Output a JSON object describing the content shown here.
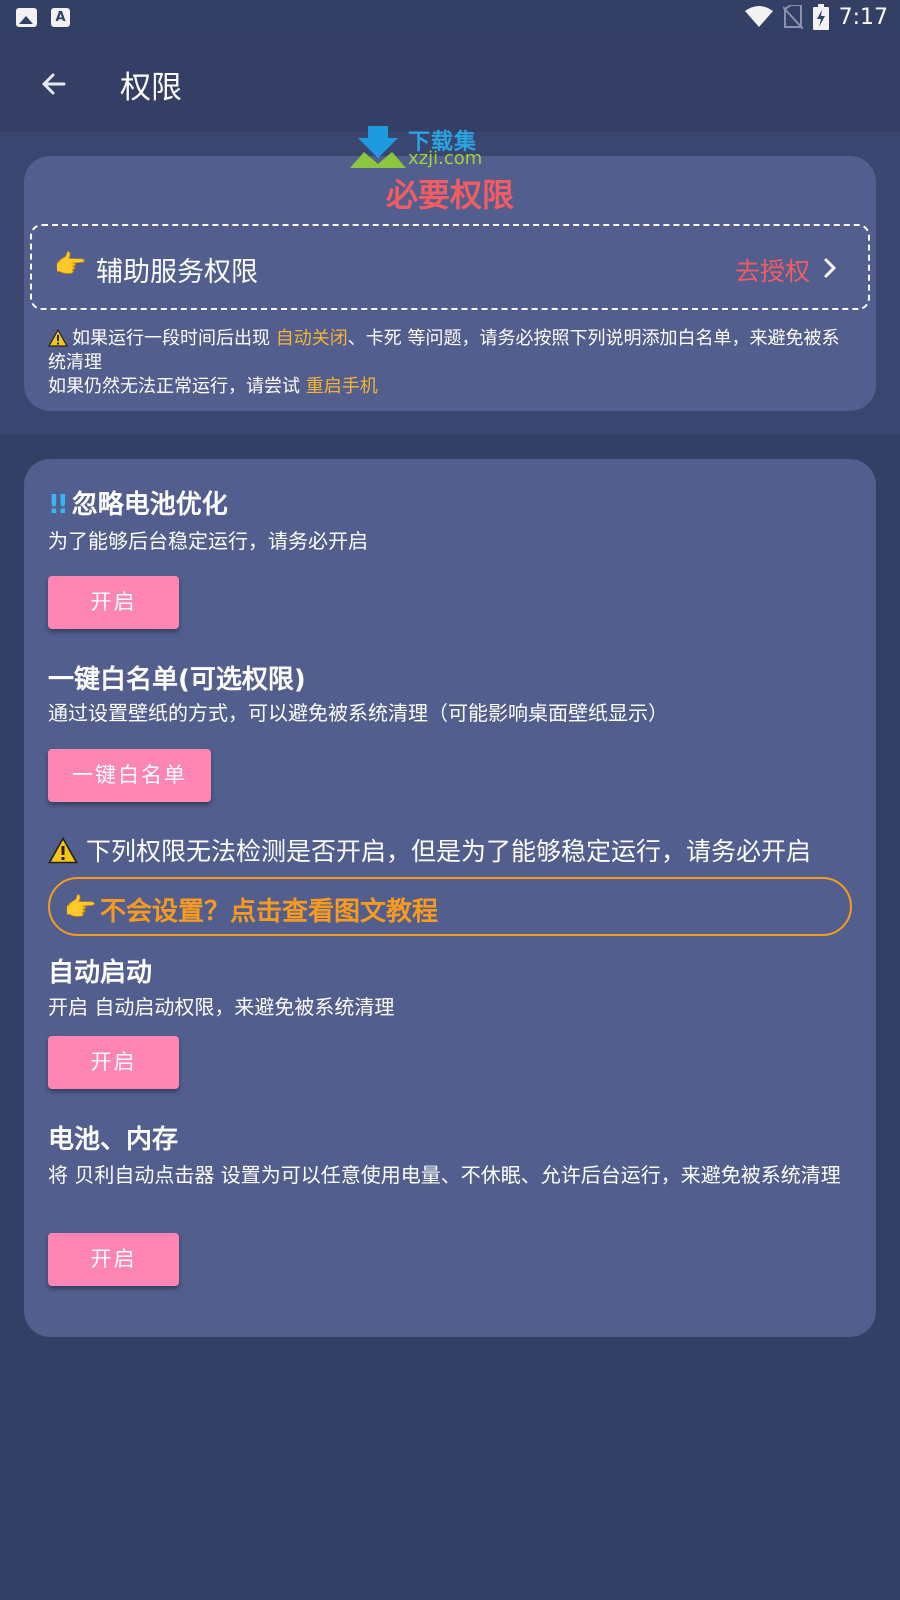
{
  "status_bar": {
    "time": "7:17",
    "left_icons": [
      "image-icon",
      "font-a-icon"
    ],
    "right_icons": [
      "wifi-icon",
      "no-sim-icon",
      "battery-charging-icon"
    ]
  },
  "app_bar": {
    "title": "权限",
    "back_icon": "arrow-left-icon"
  },
  "watermark": {
    "line1": "下载集",
    "line2": "xzji.com"
  },
  "required_card": {
    "title": "必要权限",
    "accessibility": {
      "label": "辅助服务权限",
      "action": "去授权"
    },
    "note_line1_pre": "如果运行一段时间后出现 ",
    "note_line1_hl": "自动关闭",
    "note_line1_post": "、卡死 等问题，请务必按照下列说明添加白名单，来避免被系统清理",
    "note_line2_pre": "如果仍然无法正常运行，请尝试 ",
    "note_line2_hl": "重启手机"
  },
  "battery_opt": {
    "title": "忽略电池优化",
    "desc": "为了能够后台稳定运行，请务必开启",
    "button": "开启"
  },
  "whitelist": {
    "title": "一键白名单(可选权限)",
    "desc": "通过设置壁纸的方式，可以避免被系统清理（可能影响桌面壁纸显示）",
    "button": "一键白名单"
  },
  "warning": {
    "text": "下列权限无法检测是否开启，但是为了能够稳定运行，请务必开启",
    "tutorial": "不会设置？点击查看图文教程"
  },
  "autostart": {
    "title": "自动启动",
    "desc": "开启 自动启动权限，来避免被系统清理",
    "button": "开启"
  },
  "battery_memory": {
    "title": "电池、内存",
    "desc": "将 贝利自动点击器 设置为可以任意使用电量、不休眠、允许后台运行，来避免被系统清理",
    "button": "开启"
  },
  "colors": {
    "background": "#343f66",
    "card": "#525e8d",
    "accent_red": "#f25c63",
    "accent_orange": "#f79a1f",
    "highlight": "#f5b335",
    "button_pink": "#ff85b3",
    "exclaim_blue": "#38b6f0"
  }
}
